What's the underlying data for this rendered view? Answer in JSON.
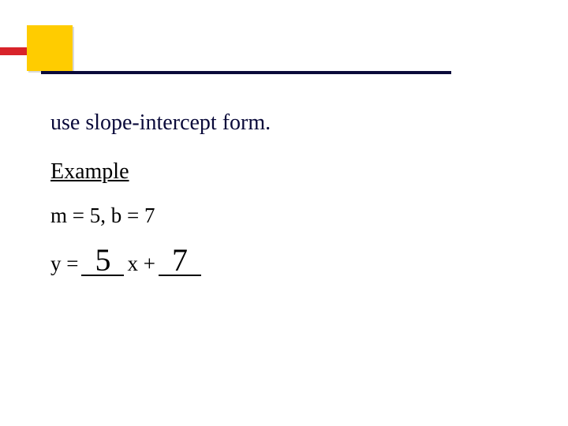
{
  "title": "use slope-intercept form.",
  "example_heading": "Example",
  "given": "m = 5, b = 7",
  "equation": {
    "y_prefix": "y = ",
    "slope_value": "5",
    "mid": " x + ",
    "intercept_value": "7"
  }
}
